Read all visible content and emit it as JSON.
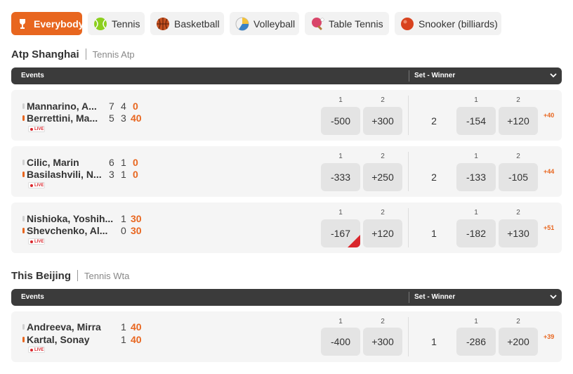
{
  "tabs": [
    {
      "label": "Everybody",
      "icon": "trophy-icon",
      "active": true
    },
    {
      "label": "Tennis",
      "icon": "tennis-ball-icon",
      "active": false
    },
    {
      "label": "Basketball",
      "icon": "basketball-icon",
      "active": false
    },
    {
      "label": "Volleyball",
      "icon": "volleyball-icon",
      "active": false
    },
    {
      "label": "Table Tennis",
      "icon": "table-tennis-icon",
      "active": false
    },
    {
      "label": "Snooker (billiards)",
      "icon": "snooker-ball-icon",
      "active": false
    }
  ],
  "leagues": [
    {
      "name": "Atp Shanghai",
      "sub": "Tennis Atp",
      "header": {
        "events": "Events",
        "market": "Set - Winner"
      },
      "matches": [
        {
          "team1": "Mannarino, A...",
          "team1_scores": [
            "7",
            "4"
          ],
          "team1_point": "0",
          "team2": "Berrettini, Ma...",
          "team2_scores": [
            "5",
            "3"
          ],
          "team2_point": "40",
          "serving": 2,
          "live": "LIVE",
          "match_labels": [
            "1",
            "2"
          ],
          "match_odds": [
            "-500",
            "+300"
          ],
          "set": "2",
          "set_labels": [
            "1",
            "2"
          ],
          "set_odds": [
            "-154",
            "+120"
          ],
          "more": "+40"
        },
        {
          "team1": "Cilic, Marin",
          "team1_scores": [
            "6",
            "1"
          ],
          "team1_point": "0",
          "team2": "Basilashvili, N...",
          "team2_scores": [
            "3",
            "1"
          ],
          "team2_point": "0",
          "serving": 2,
          "live": "LIVE",
          "match_labels": [
            "1",
            "2"
          ],
          "match_odds": [
            "-333",
            "+250"
          ],
          "set": "2",
          "set_labels": [
            "1",
            "2"
          ],
          "set_odds": [
            "-133",
            "-105"
          ],
          "more": "+44"
        },
        {
          "team1": "Nishioka, Yoshih...",
          "team1_scores": [
            "1"
          ],
          "team1_point": "30",
          "team2": "Shevchenko, Al...",
          "team2_scores": [
            "0"
          ],
          "team2_point": "30",
          "serving": 2,
          "live": "LIVE",
          "match_labels": [
            "1",
            "2"
          ],
          "match_odds": [
            "-167",
            "+120"
          ],
          "set": "1",
          "set_labels": [
            "1",
            "2"
          ],
          "set_odds": [
            "-182",
            "+130"
          ],
          "more": "+51"
        }
      ]
    },
    {
      "name": "This Beijing",
      "sub": "Tennis Wta",
      "header": {
        "events": "Events",
        "market": "Set - Winner"
      },
      "matches": [
        {
          "team1": "Andreeva, Mirra",
          "team1_scores": [
            "1"
          ],
          "team1_point": "40",
          "team2": "Kartal, Sonay",
          "team2_scores": [
            "1"
          ],
          "team2_point": "40",
          "serving": 2,
          "live": "LIVE",
          "match_labels": [
            "1",
            "2"
          ],
          "match_odds": [
            "-400",
            "+300"
          ],
          "set": "1",
          "set_labels": [
            "1",
            "2"
          ],
          "set_odds": [
            "-286",
            "+200"
          ],
          "more": "+39"
        }
      ]
    }
  ],
  "colors": {
    "accent": "#e8661f",
    "header": "#3b3b3b",
    "card": "#f5f5f5",
    "odd": "#e4e4e4",
    "live": "#d9262c"
  }
}
